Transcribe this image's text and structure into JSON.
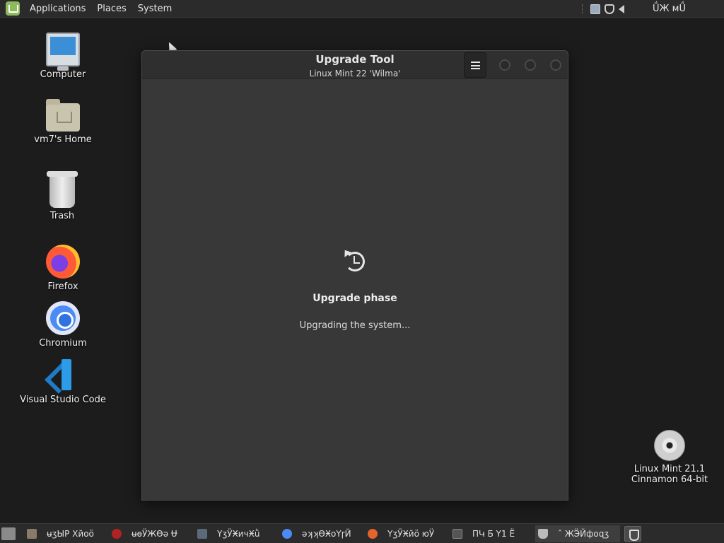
{
  "top_panel": {
    "menus": [
      "Applications",
      "Places",
      "System"
    ],
    "clock": "ǗЖ мǗ"
  },
  "desktop_icons": [
    {
      "label": "Computer",
      "icon": "computer-icon"
    },
    {
      "label": "vm7's Home",
      "icon": "home-folder-icon"
    },
    {
      "label": "Trash",
      "icon": "trash-icon"
    },
    {
      "label": "Firefox",
      "icon": "firefox-icon"
    },
    {
      "label": "Chromium",
      "icon": "chromium-icon"
    },
    {
      "label": "Visual Studio Code",
      "icon": "vscode-icon"
    },
    {
      "label_line1": "Linux Mint 21.1",
      "label_line2": "Cinnamon 64-bit",
      "icon": "dvd-icon"
    }
  ],
  "window": {
    "title": "Upgrade Tool",
    "subtitle": "Linux Mint 22 'Wilma'",
    "menu_icon": "hamburger-menu-icon",
    "phase_icon": "upgrade-phase-icon",
    "phase_title": "Upgrade phase",
    "phase_status": "Upgrading the system..."
  },
  "taskbar": {
    "tasks": [
      {
        "label": "ʉʒЫР Хйоӧ",
        "icon": "files-icon",
        "color": "#8a7b66"
      },
      {
        "label": "ʉɵӰЖѲə Ʉ",
        "icon": "opera-icon",
        "color": "#b22222"
      },
      {
        "label": "ҮʒӰӾичӾǜ",
        "icon": "monitor-icon",
        "color": "#5a6a7a"
      },
      {
        "label": "əʞʞƟӾоҮɼЙ",
        "icon": "chromium-icon",
        "color": "#4c8bf5"
      },
      {
        "label": "ҮʒӰӾйӧ юӰ",
        "icon": "firefox-icon",
        "color": "#e5632c"
      },
      {
        "label": "ПԿ Ƃ Ү1 Ё",
        "icon": "terminal-icon",
        "color": "#555555"
      },
      {
        "label": "ˆ ЖӬЙфоɋʒ",
        "icon": "upgrade-tool-icon",
        "color": "#bbbbbb"
      }
    ]
  }
}
